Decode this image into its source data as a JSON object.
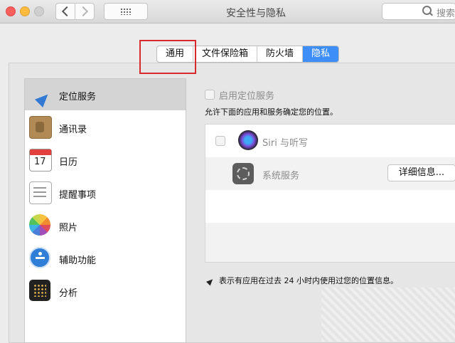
{
  "window": {
    "title": "安全性与隐私"
  },
  "search": {
    "placeholder": "搜索"
  },
  "tabs": [
    {
      "label": "通用",
      "active": false
    },
    {
      "label": "文件保险箱",
      "active": false
    },
    {
      "label": "防火墙",
      "active": false
    },
    {
      "label": "隐私",
      "active": true
    }
  ],
  "sidebar": {
    "items": [
      {
        "label": "定位服务",
        "icon": "location-arrow-icon",
        "selected": true
      },
      {
        "label": "通讯录",
        "icon": "contacts-book-icon",
        "selected": false
      },
      {
        "label": "日历",
        "icon": "calendar-icon",
        "calendar_day": "17",
        "selected": false
      },
      {
        "label": "提醒事项",
        "icon": "reminders-icon",
        "selected": false
      },
      {
        "label": "照片",
        "icon": "photos-icon",
        "selected": false
      },
      {
        "label": "辅助功能",
        "icon": "accessibility-icon",
        "selected": false
      },
      {
        "label": "分析",
        "icon": "analytics-icon",
        "selected": false
      }
    ]
  },
  "location": {
    "enable_label": "启用定位服务",
    "enabled": false,
    "description": "允许下面的应用和服务确定您的位置。",
    "apps": [
      {
        "name": "Siri 与听写",
        "icon": "siri-icon",
        "checked": false
      },
      {
        "name": "系统服务",
        "icon": "system-services-gear-icon",
        "button_label": "详细信息..."
      }
    ],
    "note": "表示有应用在过去 24 小时内使用过您的位置信息。"
  },
  "colors": {
    "accent": "#3d8ef7",
    "highlight_box": "#d82a2a"
  }
}
